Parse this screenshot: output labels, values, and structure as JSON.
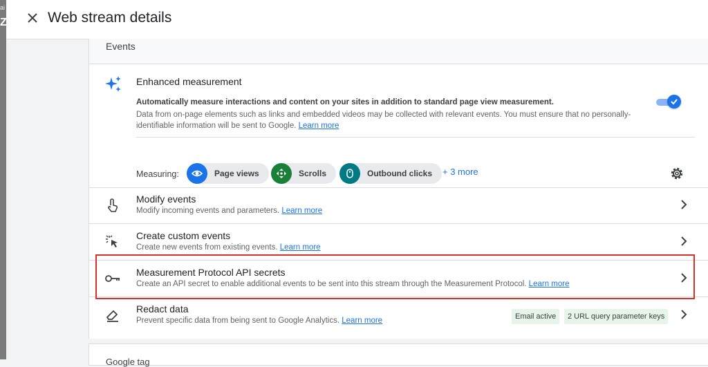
{
  "background_strip": {
    "glyph1": "ai",
    "glyph2": "Z"
  },
  "header": {
    "title": "Web stream details"
  },
  "events_section": {
    "title": "Events"
  },
  "enhanced": {
    "title": "Enhanced measurement",
    "desc_bold": "Automatically measure interactions and content on your sites in addition to standard page view measurement.",
    "desc": "Data from on-page elements such as links and embedded videos may be collected with relevant events. You must ensure that no personally-identifiable information will be sent to Google.",
    "learn_more": "Learn more",
    "toggle_on": true,
    "measuring_label": "Measuring:",
    "chips": [
      {
        "label": "Page views",
        "icon": "eye-icon",
        "color": "#1a73e8"
      },
      {
        "label": "Scrolls",
        "icon": "scroll-icon",
        "color": "#188038"
      },
      {
        "label": "Outbound clicks",
        "icon": "mouse-icon",
        "color": "#007b83"
      }
    ],
    "more_label": "+ 3 more"
  },
  "rows": [
    {
      "title": "Modify events",
      "desc": "Modify incoming events and parameters.",
      "learn_more": "Learn more"
    },
    {
      "title": "Create custom events",
      "desc": "Create new events from existing events.",
      "learn_more": "Learn more"
    },
    {
      "title": "Measurement Protocol API secrets",
      "desc": "Create an API secret to enable additional events to be sent into this stream through the Measurement Protocol.",
      "learn_more": "Learn more"
    },
    {
      "title": "Redact data",
      "desc": "Prevent specific data from being sent to Google Analytics.",
      "learn_more": "Learn more",
      "badges": [
        "Email active",
        "2 URL query parameter keys"
      ]
    }
  ],
  "next_section": {
    "title": "Google tag"
  },
  "colors": {
    "accent": "#1a73e8",
    "highlight": "#d93025",
    "badge_bg": "#e6f4ea"
  }
}
